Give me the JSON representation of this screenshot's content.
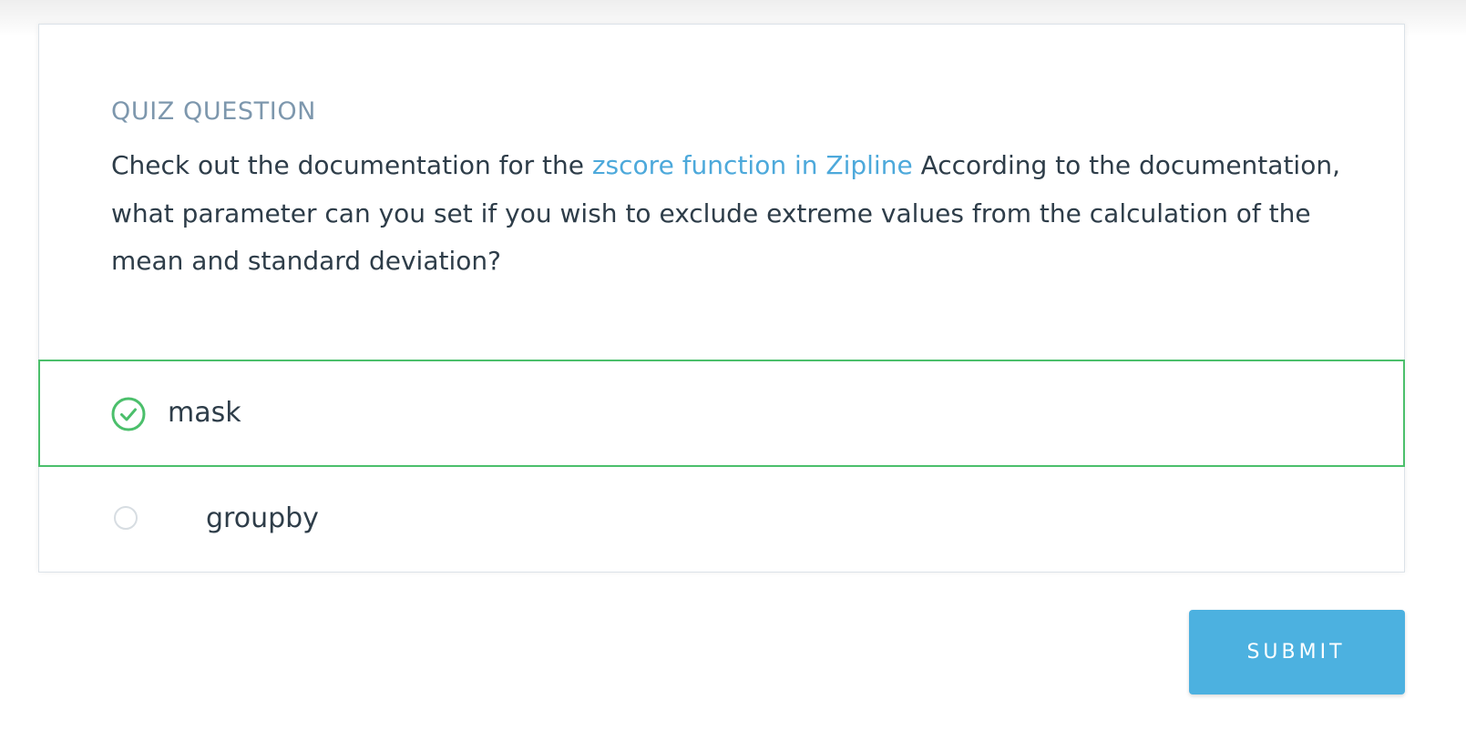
{
  "quiz": {
    "label": "QUIZ QUESTION",
    "question_before": "Check out the documentation for the ",
    "question_link": "zscore function in Zipline",
    "question_after": " According to the documentation, what parameter can you set if you wish to exclude extreme values from the calculation of the mean and standard deviation?",
    "options": [
      {
        "label": "mask",
        "state": "selected-correct",
        "icon": "check-circle-icon"
      },
      {
        "label": "groupby",
        "state": "unselected",
        "icon": "radio-empty-icon"
      }
    ]
  },
  "actions": {
    "submit_label": "SUBMIT"
  },
  "colors": {
    "accent_link": "#4da9db",
    "correct_green": "#4bbf6b",
    "submit_bg": "#4cb1e0",
    "label_gray": "#7d97ad",
    "text_dark": "#2e3d49"
  }
}
